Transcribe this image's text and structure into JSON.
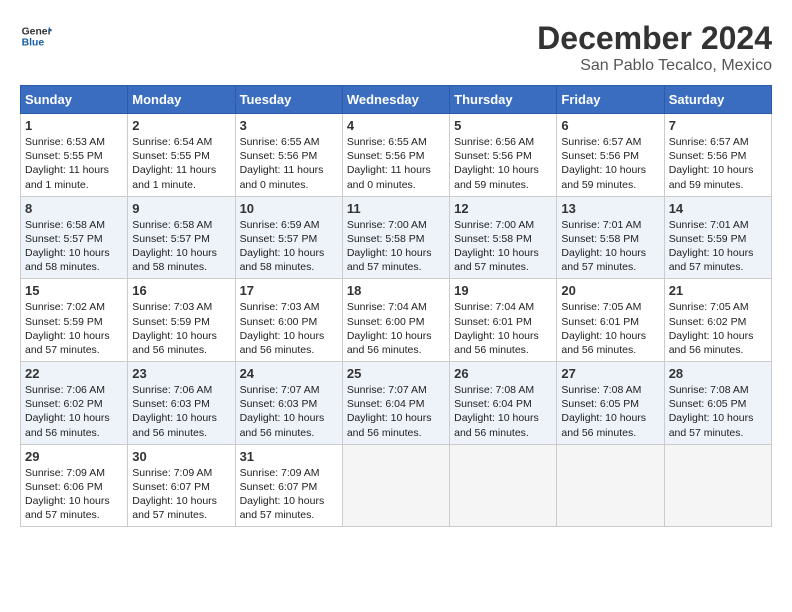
{
  "header": {
    "logo_line1": "General",
    "logo_line2": "Blue",
    "title": "December 2024",
    "subtitle": "San Pablo Tecalco, Mexico"
  },
  "calendar": {
    "days_of_week": [
      "Sunday",
      "Monday",
      "Tuesday",
      "Wednesday",
      "Thursday",
      "Friday",
      "Saturday"
    ],
    "weeks": [
      [
        {
          "day": 1,
          "info": "Sunrise: 6:53 AM\nSunset: 5:55 PM\nDaylight: 11 hours and 1 minute."
        },
        {
          "day": 2,
          "info": "Sunrise: 6:54 AM\nSunset: 5:55 PM\nDaylight: 11 hours and 1 minute."
        },
        {
          "day": 3,
          "info": "Sunrise: 6:55 AM\nSunset: 5:56 PM\nDaylight: 11 hours and 0 minutes."
        },
        {
          "day": 4,
          "info": "Sunrise: 6:55 AM\nSunset: 5:56 PM\nDaylight: 11 hours and 0 minutes."
        },
        {
          "day": 5,
          "info": "Sunrise: 6:56 AM\nSunset: 5:56 PM\nDaylight: 10 hours and 59 minutes."
        },
        {
          "day": 6,
          "info": "Sunrise: 6:57 AM\nSunset: 5:56 PM\nDaylight: 10 hours and 59 minutes."
        },
        {
          "day": 7,
          "info": "Sunrise: 6:57 AM\nSunset: 5:56 PM\nDaylight: 10 hours and 59 minutes."
        }
      ],
      [
        {
          "day": 8,
          "info": "Sunrise: 6:58 AM\nSunset: 5:57 PM\nDaylight: 10 hours and 58 minutes."
        },
        {
          "day": 9,
          "info": "Sunrise: 6:58 AM\nSunset: 5:57 PM\nDaylight: 10 hours and 58 minutes."
        },
        {
          "day": 10,
          "info": "Sunrise: 6:59 AM\nSunset: 5:57 PM\nDaylight: 10 hours and 58 minutes."
        },
        {
          "day": 11,
          "info": "Sunrise: 7:00 AM\nSunset: 5:58 PM\nDaylight: 10 hours and 57 minutes."
        },
        {
          "day": 12,
          "info": "Sunrise: 7:00 AM\nSunset: 5:58 PM\nDaylight: 10 hours and 57 minutes."
        },
        {
          "day": 13,
          "info": "Sunrise: 7:01 AM\nSunset: 5:58 PM\nDaylight: 10 hours and 57 minutes."
        },
        {
          "day": 14,
          "info": "Sunrise: 7:01 AM\nSunset: 5:59 PM\nDaylight: 10 hours and 57 minutes."
        }
      ],
      [
        {
          "day": 15,
          "info": "Sunrise: 7:02 AM\nSunset: 5:59 PM\nDaylight: 10 hours and 57 minutes."
        },
        {
          "day": 16,
          "info": "Sunrise: 7:03 AM\nSunset: 5:59 PM\nDaylight: 10 hours and 56 minutes."
        },
        {
          "day": 17,
          "info": "Sunrise: 7:03 AM\nSunset: 6:00 PM\nDaylight: 10 hours and 56 minutes."
        },
        {
          "day": 18,
          "info": "Sunrise: 7:04 AM\nSunset: 6:00 PM\nDaylight: 10 hours and 56 minutes."
        },
        {
          "day": 19,
          "info": "Sunrise: 7:04 AM\nSunset: 6:01 PM\nDaylight: 10 hours and 56 minutes."
        },
        {
          "day": 20,
          "info": "Sunrise: 7:05 AM\nSunset: 6:01 PM\nDaylight: 10 hours and 56 minutes."
        },
        {
          "day": 21,
          "info": "Sunrise: 7:05 AM\nSunset: 6:02 PM\nDaylight: 10 hours and 56 minutes."
        }
      ],
      [
        {
          "day": 22,
          "info": "Sunrise: 7:06 AM\nSunset: 6:02 PM\nDaylight: 10 hours and 56 minutes."
        },
        {
          "day": 23,
          "info": "Sunrise: 7:06 AM\nSunset: 6:03 PM\nDaylight: 10 hours and 56 minutes."
        },
        {
          "day": 24,
          "info": "Sunrise: 7:07 AM\nSunset: 6:03 PM\nDaylight: 10 hours and 56 minutes."
        },
        {
          "day": 25,
          "info": "Sunrise: 7:07 AM\nSunset: 6:04 PM\nDaylight: 10 hours and 56 minutes."
        },
        {
          "day": 26,
          "info": "Sunrise: 7:08 AM\nSunset: 6:04 PM\nDaylight: 10 hours and 56 minutes."
        },
        {
          "day": 27,
          "info": "Sunrise: 7:08 AM\nSunset: 6:05 PM\nDaylight: 10 hours and 56 minutes."
        },
        {
          "day": 28,
          "info": "Sunrise: 7:08 AM\nSunset: 6:05 PM\nDaylight: 10 hours and 57 minutes."
        }
      ],
      [
        {
          "day": 29,
          "info": "Sunrise: 7:09 AM\nSunset: 6:06 PM\nDaylight: 10 hours and 57 minutes."
        },
        {
          "day": 30,
          "info": "Sunrise: 7:09 AM\nSunset: 6:07 PM\nDaylight: 10 hours and 57 minutes."
        },
        {
          "day": 31,
          "info": "Sunrise: 7:09 AM\nSunset: 6:07 PM\nDaylight: 10 hours and 57 minutes."
        },
        null,
        null,
        null,
        null
      ]
    ]
  }
}
